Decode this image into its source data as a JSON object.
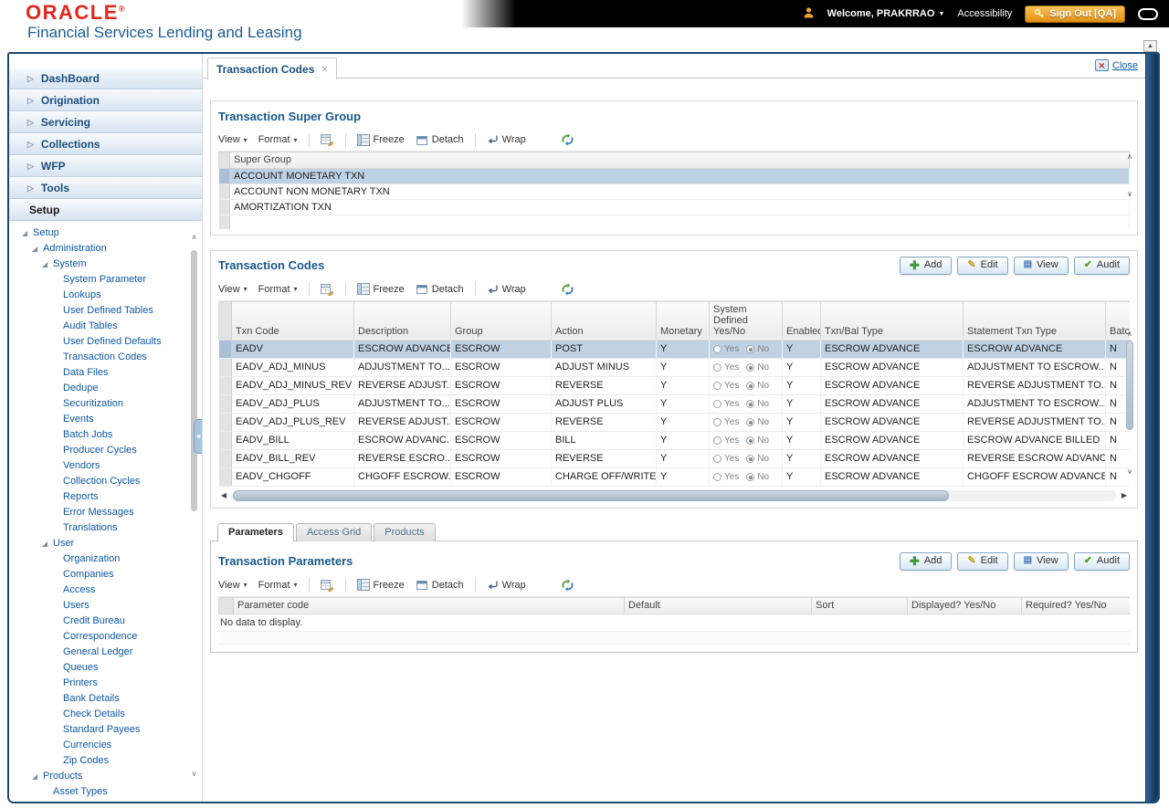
{
  "labels": {
    "yes": "Yes",
    "no": "No"
  },
  "header": {
    "brand": "ORACLE",
    "trademark": "®",
    "subtitle": "Financial Services Lending and Leasing",
    "welcome": "Welcome, PRAKRRAO",
    "accessibility": "Accessibility",
    "sign_out": "Sign Out [QA]"
  },
  "sidebar": {
    "accordion": [
      "DashBoard",
      "Origination",
      "Servicing",
      "Collections",
      "WFP",
      "Tools"
    ],
    "setup_label": "Setup",
    "tree": [
      {
        "label": "Setup",
        "level": 0,
        "expanded": true
      },
      {
        "label": "Administration",
        "level": 1,
        "expanded": true
      },
      {
        "label": "System",
        "level": 2,
        "expanded": true
      },
      {
        "label": "System Parameter",
        "level": 3
      },
      {
        "label": "Lookups",
        "level": 3
      },
      {
        "label": "User Defined Tables",
        "level": 3
      },
      {
        "label": "Audit Tables",
        "level": 3
      },
      {
        "label": "User Defined Defaults",
        "level": 3
      },
      {
        "label": "Transaction Codes",
        "level": 3
      },
      {
        "label": "Data Files",
        "level": 3
      },
      {
        "label": "Dedupe",
        "level": 3
      },
      {
        "label": "Securitization",
        "level": 3
      },
      {
        "label": "Events",
        "level": 3
      },
      {
        "label": "Batch Jobs",
        "level": 3
      },
      {
        "label": "Producer Cycles",
        "level": 3
      },
      {
        "label": "Vendors",
        "level": 3
      },
      {
        "label": "Collection Cycles",
        "level": 3
      },
      {
        "label": "Reports",
        "level": 3
      },
      {
        "label": "Error Messages",
        "level": 3
      },
      {
        "label": "Translations",
        "level": 3
      },
      {
        "label": "User",
        "level": 2,
        "expanded": true
      },
      {
        "label": "Organization",
        "level": 3
      },
      {
        "label": "Companies",
        "level": 3
      },
      {
        "label": "Access",
        "level": 3
      },
      {
        "label": "Users",
        "level": 3
      },
      {
        "label": "Credit Bureau",
        "level": 3
      },
      {
        "label": "Correspondence",
        "level": 3
      },
      {
        "label": "General Ledger",
        "level": 3
      },
      {
        "label": "Queues",
        "level": 3
      },
      {
        "label": "Printers",
        "level": 3
      },
      {
        "label": "Bank Details",
        "level": 3
      },
      {
        "label": "Check Details",
        "level": 3
      },
      {
        "label": "Standard Payees",
        "level": 3
      },
      {
        "label": "Currencies",
        "level": 3
      },
      {
        "label": "Zip Codes",
        "level": 3
      },
      {
        "label": "Products",
        "level": 1,
        "expanded": true
      },
      {
        "label": "Asset Types",
        "level": 2
      }
    ]
  },
  "tabbar": {
    "tab": "Transaction Codes",
    "close": "Close"
  },
  "toolbar": {
    "view": "View",
    "format": "Format",
    "freeze": "Freeze",
    "detach": "Detach",
    "wrap": "Wrap"
  },
  "actions": {
    "add": "Add",
    "edit": "Edit",
    "view": "View",
    "audit": "Audit"
  },
  "super_group": {
    "title": "Transaction Super Group",
    "columns": [
      "Super Group"
    ],
    "rows": [
      {
        "label": "ACCOUNT MONETARY TXN",
        "selected": true
      },
      {
        "label": "ACCOUNT NON MONETARY TXN"
      },
      {
        "label": "AMORTIZATION TXN"
      }
    ]
  },
  "txn_codes": {
    "title": "Transaction Codes",
    "columns": [
      "Txn Code",
      "Description",
      "Group",
      "Action",
      "Monetary",
      "System Defined Yes/No",
      "Enabled",
      "Txn/Bal Type",
      "Statement Txn Type",
      "Batch"
    ],
    "rows": [
      {
        "txn_code": "EADV",
        "description": "ESCROW ADVANCE",
        "group": "ESCROW",
        "action": "POST",
        "monetary": "Y",
        "system_defined": "No",
        "enabled": "Y",
        "txn_bal_type": "ESCROW ADVANCE",
        "statement_txn_type": "ESCROW ADVANCE",
        "batch": "N",
        "selected": true
      },
      {
        "txn_code": "EADV_ADJ_MINUS",
        "description": "ADJUSTMENT TO...",
        "group": "ESCROW",
        "action": "ADJUST MINUS",
        "monetary": "Y",
        "system_defined": "No",
        "enabled": "Y",
        "txn_bal_type": "ESCROW ADVANCE",
        "statement_txn_type": "ADJUSTMENT TO ESCROW...",
        "batch": "N"
      },
      {
        "txn_code": "EADV_ADJ_MINUS_REV",
        "description": "REVERSE ADJUST...",
        "group": "ESCROW",
        "action": "REVERSE",
        "monetary": "Y",
        "system_defined": "No",
        "enabled": "Y",
        "txn_bal_type": "ESCROW ADVANCE",
        "statement_txn_type": "REVERSE ADJUSTMENT TO...",
        "batch": "N"
      },
      {
        "txn_code": "EADV_ADJ_PLUS",
        "description": "ADJUSTMENT TO...",
        "group": "ESCROW",
        "action": "ADJUST PLUS",
        "monetary": "Y",
        "system_defined": "No",
        "enabled": "Y",
        "txn_bal_type": "ESCROW ADVANCE",
        "statement_txn_type": "ADJUSTMENT TO ESCROW...",
        "batch": "N"
      },
      {
        "txn_code": "EADV_ADJ_PLUS_REV",
        "description": "REVERSE ADJUST...",
        "group": "ESCROW",
        "action": "REVERSE",
        "monetary": "Y",
        "system_defined": "No",
        "enabled": "Y",
        "txn_bal_type": "ESCROW ADVANCE",
        "statement_txn_type": "REVERSE ADJUSTMENT TO...",
        "batch": "N"
      },
      {
        "txn_code": "EADV_BILL",
        "description": "ESCROW ADVANC...",
        "group": "ESCROW",
        "action": "BILL",
        "monetary": "Y",
        "system_defined": "No",
        "enabled": "Y",
        "txn_bal_type": "ESCROW ADVANCE",
        "statement_txn_type": "ESCROW ADVANCE BILLED",
        "batch": "N"
      },
      {
        "txn_code": "EADV_BILL_REV",
        "description": "REVERSE ESCRO...",
        "group": "ESCROW",
        "action": "REVERSE",
        "monetary": "Y",
        "system_defined": "No",
        "enabled": "Y",
        "txn_bal_type": "ESCROW ADVANCE",
        "statement_txn_type": "REVERSE ESCROW ADVANC...",
        "batch": "N"
      },
      {
        "txn_code": "EADV_CHGOFF",
        "description": "CHGOFF ESCROW...",
        "group": "ESCROW",
        "action": "CHARGE OFF/WRITE...",
        "monetary": "Y",
        "system_defined": "No",
        "enabled": "Y",
        "txn_bal_type": "ESCROW ADVANCE",
        "statement_txn_type": "CHGOFF ESCROW ADVANCE",
        "batch": "N"
      }
    ]
  },
  "subtabs": [
    "Parameters",
    "Access Grid",
    "Products"
  ],
  "params": {
    "title": "Transaction Parameters",
    "columns": [
      "Parameter code",
      "Default",
      "Sort",
      "Displayed? Yes/No",
      "Required? Yes/No"
    ],
    "empty": "No data to display."
  }
}
